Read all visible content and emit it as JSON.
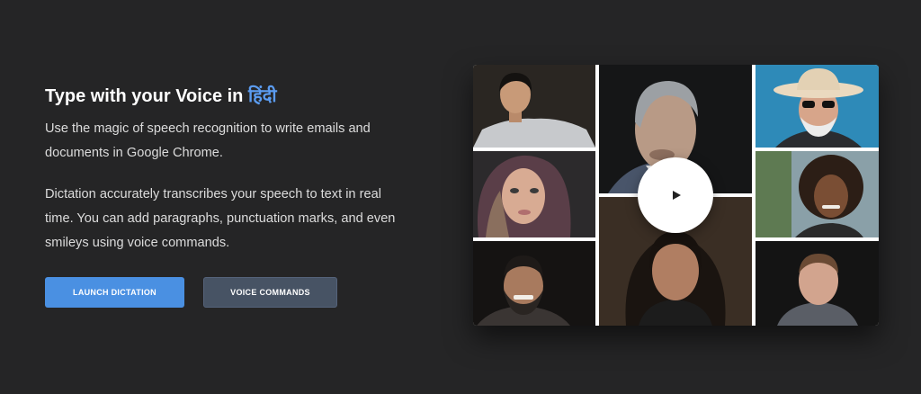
{
  "hero": {
    "headline": "Type with your Voice in",
    "language": "हिंदी",
    "paragraph_1": "Use the magic of speech recognition to write emails and documents in Google Chrome.",
    "paragraph_2": "Dictation accurately transcribes your speech to text in real time. You can add paragraphs, punctuation marks, and even smileys using voice commands."
  },
  "buttons": {
    "launch_label": "LAUNCH DICTATION",
    "commands_label": "VOICE COMMANDS"
  },
  "colors": {
    "background": "#252526",
    "accent": "#4a90e2",
    "language_highlight": "#5b9cf0",
    "secondary_button": "#475364"
  },
  "video": {
    "play_icon": "play-icon"
  }
}
